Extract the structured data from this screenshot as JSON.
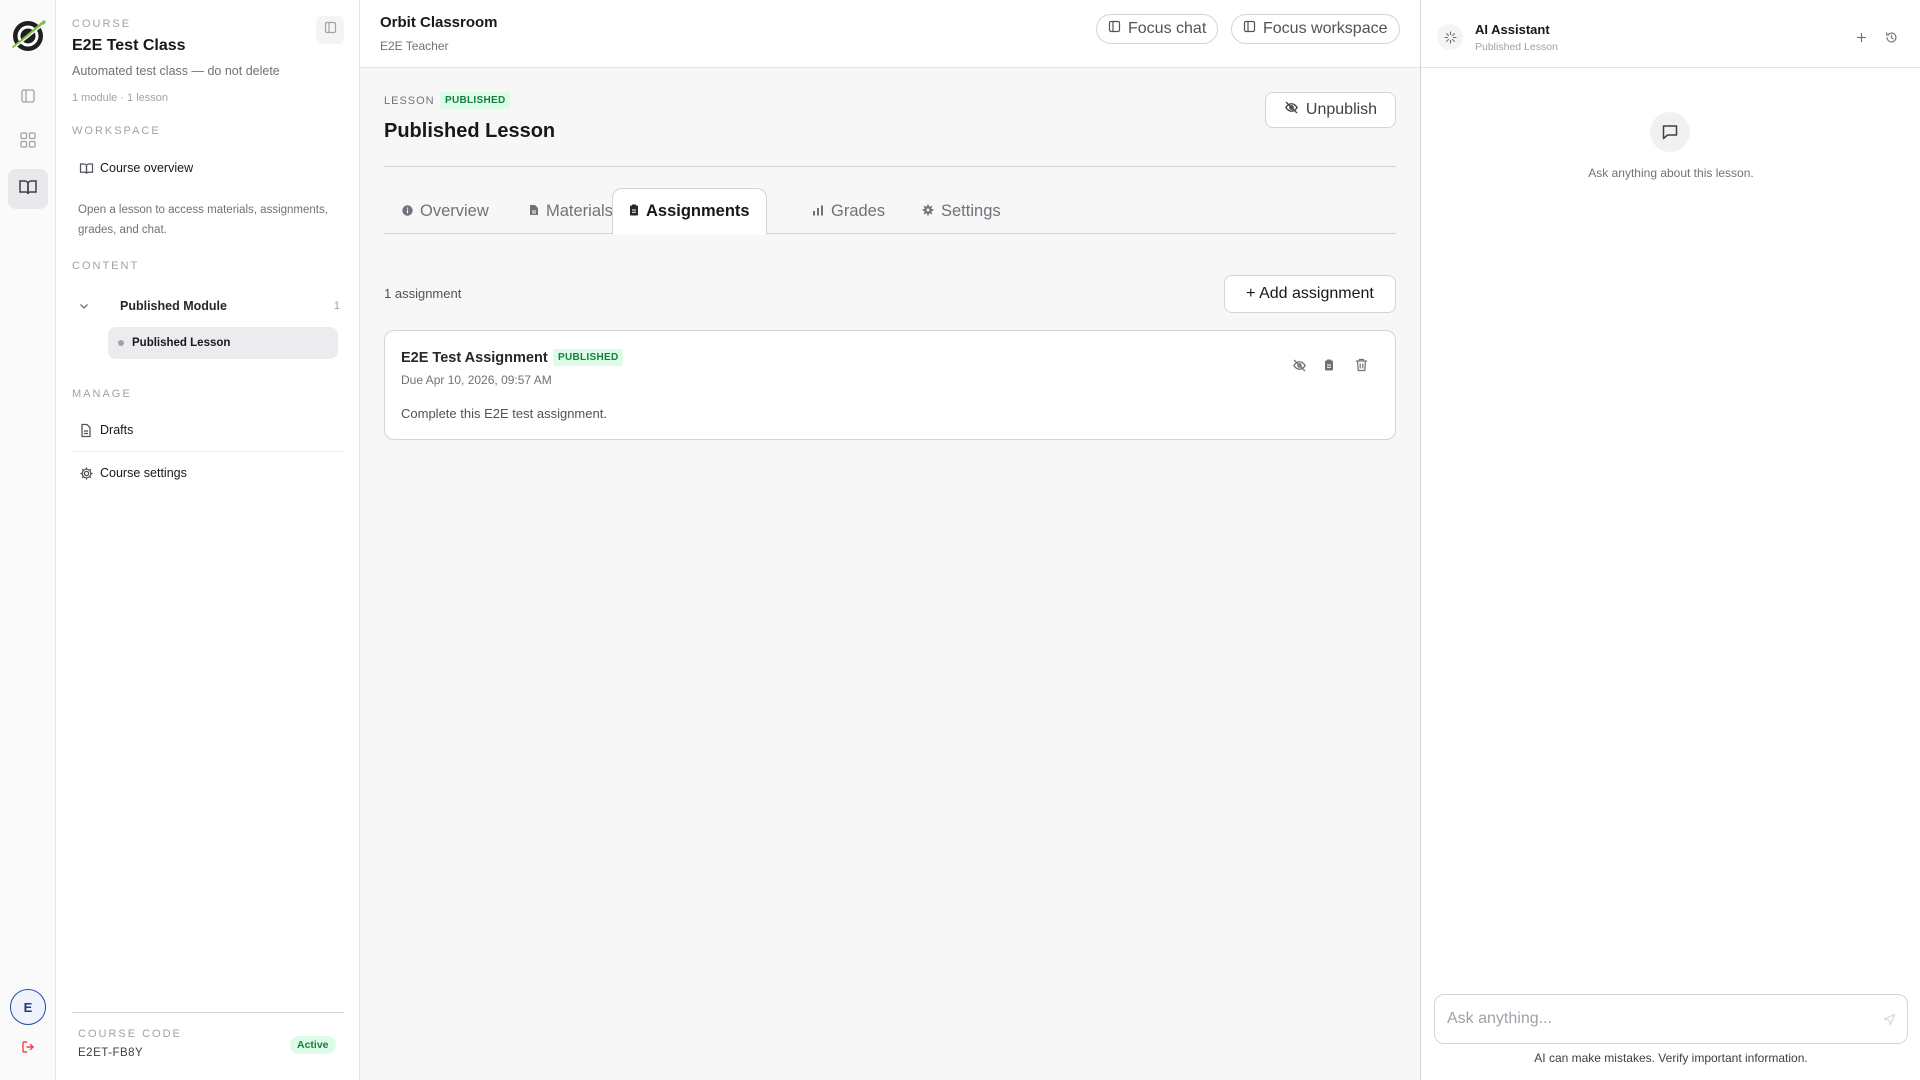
{
  "rail": {
    "items": [
      {
        "icon": "panel-icon"
      },
      {
        "icon": "grid-icon"
      },
      {
        "icon": "book-open-icon",
        "active": true
      }
    ],
    "avatar_initial": "E"
  },
  "sidebar": {
    "course_eyebrow": "COURSE",
    "course_title": "E2E Test Class",
    "course_description": "Automated test class — do not delete",
    "course_meta": "1 module · 1 lesson",
    "workspace_eyebrow": "WORKSPACE",
    "course_overview_label": "Course overview",
    "hint": "Open a lesson to access materials, assignments, grades, and chat.",
    "content_eyebrow": "CONTENT",
    "module": {
      "name": "Published Module",
      "count": "1"
    },
    "lesson": {
      "name": "Published Lesson"
    },
    "manage_eyebrow": "MANAGE",
    "drafts_label": "Drafts",
    "settings_label": "Course settings",
    "course_code_eyebrow": "COURSE CODE",
    "course_code": "E2ET-FB8Y",
    "status": "Active"
  },
  "topbar": {
    "app_title": "Orbit Classroom",
    "user_role": "E2E Teacher",
    "focus_chat_label": "Focus chat",
    "focus_workspace_label": "Focus workspace"
  },
  "lesson": {
    "eyebrow": "LESSON",
    "status_badge": "PUBLISHED",
    "title": "Published Lesson",
    "unpublish_label": "Unpublish",
    "tabs": [
      {
        "label": "Overview",
        "icon": "info-icon"
      },
      {
        "label": "Materials",
        "icon": "file-icon"
      },
      {
        "label": "Assignments",
        "icon": "clipboard-icon",
        "active": true
      },
      {
        "label": "Grades",
        "icon": "bar-chart-icon"
      },
      {
        "label": "Settings",
        "icon": "gear-icon"
      }
    ],
    "assignment_count": "1 assignment",
    "add_assignment_label": "+ Add assignment",
    "assignments": [
      {
        "title": "E2E Test Assignment",
        "status": "PUBLISHED",
        "due": "Due Apr 10, 2026, 09:57 AM",
        "description": "Complete this E2E test assignment."
      }
    ]
  },
  "assistant": {
    "title": "AI Assistant",
    "subtitle": "Published Lesson",
    "empty_text": "Ask anything about this lesson.",
    "input_placeholder": "Ask anything...",
    "disclaimer": "AI can make mistakes. Verify important information."
  },
  "colors": {
    "accent_green_bg": "#dcfce7",
    "accent_green_text": "#15803d",
    "logo_green": "#7ec242",
    "logout_red": "#ef4444",
    "avatar_blue": "#1e4fa8"
  }
}
